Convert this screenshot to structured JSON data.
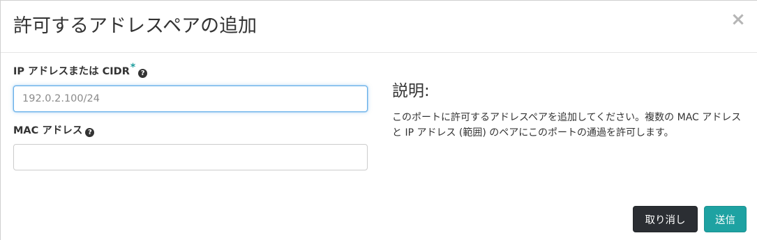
{
  "dialog": {
    "title": "許可するアドレスペアの追加",
    "close_icon": "×"
  },
  "form": {
    "ip_field": {
      "label": "IP アドレスまたは CIDR",
      "required_marker": "*",
      "help_icon": "?",
      "value": "",
      "placeholder": "192.0.2.100/24"
    },
    "mac_field": {
      "label": "MAC アドレス",
      "help_icon": "?",
      "value": "",
      "placeholder": ""
    }
  },
  "description": {
    "title": "説明:",
    "text": "このポートに許可するアドレスペアを追加してください。複数の MAC アドレスと IP アドレス (範囲) のペアにこのポートの通過を許可します。"
  },
  "footer": {
    "cancel_label": "取り消し",
    "submit_label": "送信"
  },
  "colors": {
    "accent": "#1ea2a2",
    "cancel_button": "#2b2e33",
    "focus_border": "#66afe9",
    "required_marker": "#1f9e9e"
  }
}
